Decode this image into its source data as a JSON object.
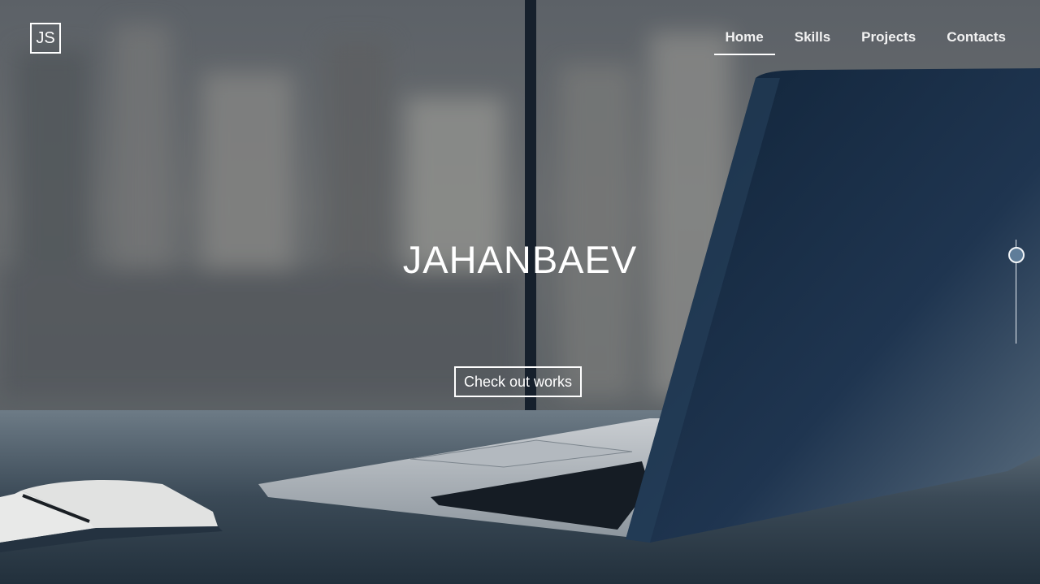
{
  "brand": {
    "logo_text": "JS"
  },
  "nav": {
    "items": [
      {
        "label": "Home",
        "active": true
      },
      {
        "label": "Skills",
        "active": false
      },
      {
        "label": "Projects",
        "active": false
      },
      {
        "label": "Contacts",
        "active": false
      }
    ]
  },
  "hero": {
    "title": "JAHANBAEV",
    "cta_label": "Check out works"
  },
  "colors": {
    "text": "#ffffff",
    "overlay": "#2f3a46",
    "scroll_indicator": "#5f7d99"
  }
}
